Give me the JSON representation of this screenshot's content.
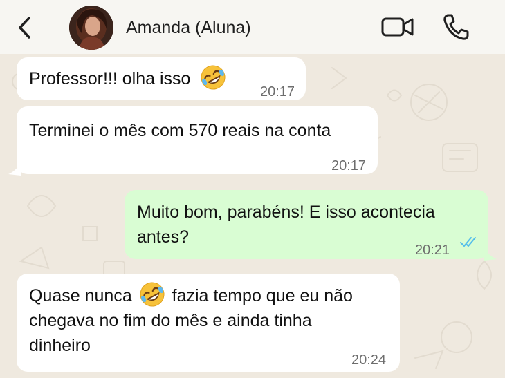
{
  "header": {
    "contact_name": "Amanda (Aluna)",
    "icons": [
      "back-arrow-icon",
      "video-call-icon",
      "phone-call-icon"
    ]
  },
  "messages": [
    {
      "direction": "incoming",
      "text_before": "Professor!!! olha isso",
      "emoji": "rolling-on-floor-laughing",
      "text_after": "",
      "time": "20:17"
    },
    {
      "direction": "incoming",
      "text": "Terminei o mês com 570 reais na conta",
      "time": "20:17"
    },
    {
      "direction": "outgoing",
      "line1": "Muito bom, parabéns! E isso acontecia",
      "line2": "antes?",
      "time": "20:21",
      "status": "read"
    },
    {
      "direction": "incoming",
      "line1_before": "Quase nunca",
      "emoji": "rolling-on-floor-laughing",
      "line1_after": "fazia tempo que eu não",
      "line2": "chegava no fim do mês e ainda tinha",
      "line3": "dinheiro",
      "time": "20:24"
    }
  ],
  "colors": {
    "header_bg": "#f7f6f2",
    "chat_bg": "#efe9df",
    "incoming_bubble": "#ffffff",
    "outgoing_bubble": "#d9fdd3",
    "read_ticks": "#53bdeb",
    "timestamp": "#6d6d6d"
  }
}
